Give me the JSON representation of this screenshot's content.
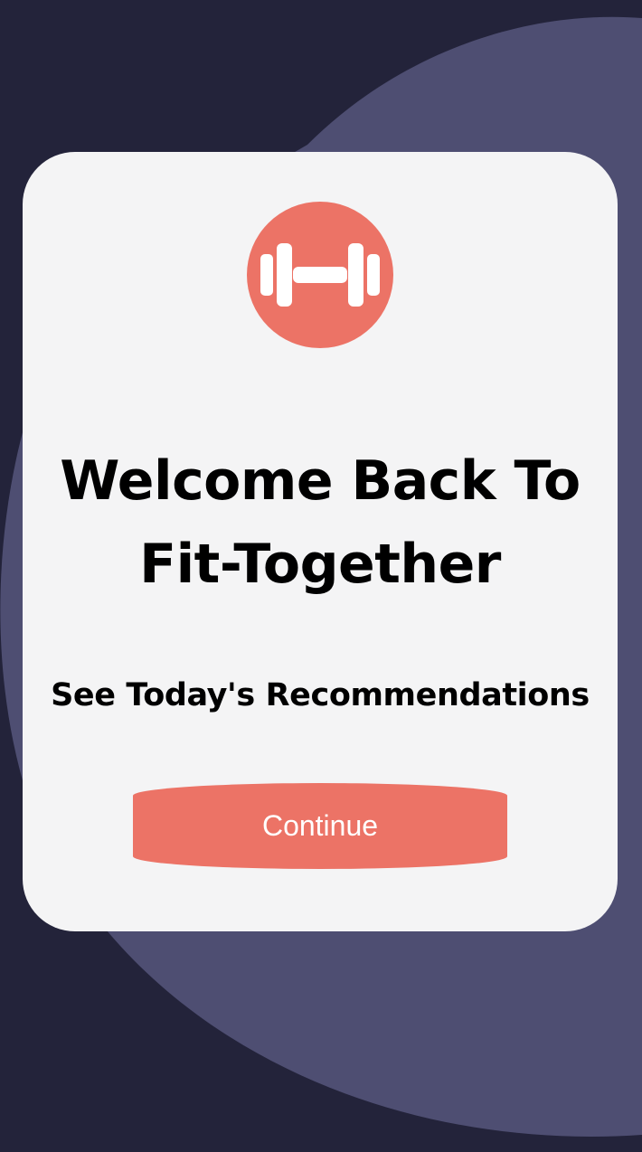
{
  "app": {
    "title_line1": "Welcome Back To",
    "title_line2": "Fit-Together",
    "subtitle": "See Today's Recommendations",
    "logo_icon": "dumbbell-icon"
  },
  "actions": {
    "continue_label": "Continue"
  },
  "colors": {
    "background": "#23233a",
    "blob": "#4e4e72",
    "card": "#f4f4f5",
    "accent": "#ec7366",
    "text": "#000000",
    "button_text": "#ffffff"
  }
}
